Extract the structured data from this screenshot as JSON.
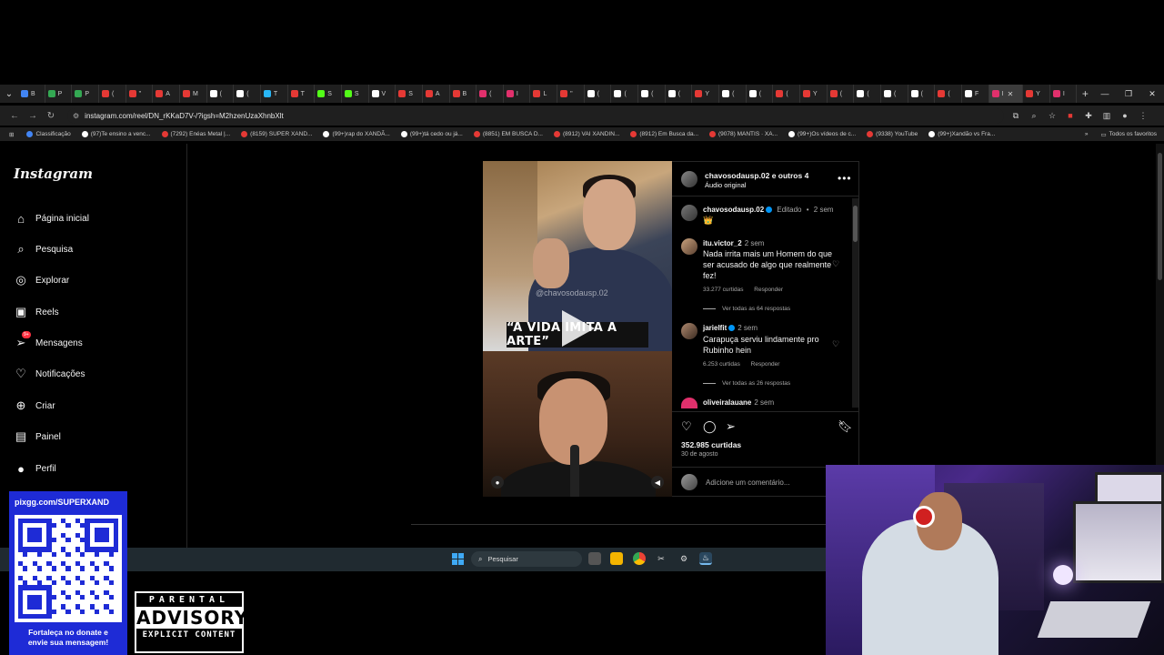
{
  "browser": {
    "tabs": [
      {
        "label": "B",
        "color": "#4285f4"
      },
      {
        "label": "P",
        "color": "#34a853"
      },
      {
        "label": "P",
        "color": "#34a853"
      },
      {
        "label": "(",
        "color": "#e53935"
      },
      {
        "label": "\"",
        "color": "#e53935"
      },
      {
        "label": "A",
        "color": "#e53935"
      },
      {
        "label": "M",
        "color": "#e53935"
      },
      {
        "label": "(",
        "color": "#ffffff"
      },
      {
        "label": "(",
        "color": "#ffffff"
      },
      {
        "label": "T",
        "color": "#29b6f6"
      },
      {
        "label": "T",
        "color": "#e53935"
      },
      {
        "label": "S",
        "color": "#53fc18"
      },
      {
        "label": "S",
        "color": "#53fc18"
      },
      {
        "label": "V",
        "color": "#ffffff"
      },
      {
        "label": "S",
        "color": "#e53935"
      },
      {
        "label": "A",
        "color": "#e53935"
      },
      {
        "label": "B",
        "color": "#e53935"
      },
      {
        "label": "(",
        "color": "#e1306c"
      },
      {
        "label": "I",
        "color": "#e1306c"
      },
      {
        "label": "L",
        "color": "#e53935"
      },
      {
        "label": "\"",
        "color": "#e53935"
      },
      {
        "label": "(",
        "color": "#ffffff"
      },
      {
        "label": "(",
        "color": "#ffffff"
      },
      {
        "label": "(",
        "color": "#ffffff"
      },
      {
        "label": "(",
        "color": "#ffffff"
      },
      {
        "label": "Y",
        "color": "#e53935"
      },
      {
        "label": "(",
        "color": "#ffffff"
      },
      {
        "label": "(",
        "color": "#ffffff"
      },
      {
        "label": "(",
        "color": "#e53935"
      },
      {
        "label": "Y",
        "color": "#e53935"
      },
      {
        "label": "(",
        "color": "#e53935"
      },
      {
        "label": "(",
        "color": "#ffffff"
      },
      {
        "label": "(",
        "color": "#ffffff"
      },
      {
        "label": "(",
        "color": "#ffffff"
      },
      {
        "label": "(",
        "color": "#e53935"
      },
      {
        "label": "F",
        "color": "#ffffff"
      }
    ],
    "active_tab": {
      "label": "I",
      "color": "#e1306c",
      "close": "✕"
    },
    "after_tabs": [
      {
        "label": "Y",
        "color": "#e53935"
      },
      {
        "label": "I",
        "color": "#e1306c"
      }
    ],
    "new_tab": "+",
    "url": "instagram.com/reel/DN_rKKaD7V-/?igsh=M2hzenUzaXhnbXlt",
    "bookmarks": [
      {
        "label": "Classificação",
        "color": "#4285f4"
      },
      {
        "label": "(97)Te ensino a venc...",
        "color": "#ffffff"
      },
      {
        "label": "(7292) Enéas Metal |...",
        "color": "#e53935"
      },
      {
        "label": "(8159) SUPER XAND...",
        "color": "#e53935"
      },
      {
        "label": "(99+)rap do XANDÃ...",
        "color": "#ffffff"
      },
      {
        "label": "(99+)tá cedo ou já...",
        "color": "#ffffff"
      },
      {
        "label": "(8851) EM BUSCA D...",
        "color": "#e53935"
      },
      {
        "label": "(8912) VAI XANDIN...",
        "color": "#e53935"
      },
      {
        "label": "(8912) Em Busca da...",
        "color": "#e53935"
      },
      {
        "label": "(9078) MANTIS · XA...",
        "color": "#e53935"
      },
      {
        "label": "(99+)Os vídeos de c...",
        "color": "#ffffff"
      },
      {
        "label": "(9338) YouTube",
        "color": "#e53935"
      },
      {
        "label": "(99+)Xandão vs Fra...",
        "color": "#ffffff"
      }
    ],
    "all_bookmarks": "Todos os favoritos"
  },
  "instagram": {
    "logo": "Instagram",
    "nav": [
      {
        "label": "Página inicial",
        "icon": "home-icon"
      },
      {
        "label": "Pesquisa",
        "icon": "search-icon"
      },
      {
        "label": "Explorar",
        "icon": "compass-icon"
      },
      {
        "label": "Reels",
        "icon": "reels-icon"
      },
      {
        "label": "Mensagens",
        "icon": "messenger-icon",
        "badge": "9+"
      },
      {
        "label": "Notificações",
        "icon": "heart-icon"
      },
      {
        "label": "Criar",
        "icon": "plus-square-icon"
      },
      {
        "label": "Painel",
        "icon": "dashboard-icon"
      },
      {
        "label": "Perfil",
        "icon": "profile-icon"
      }
    ],
    "reel": {
      "caption_text": "“A VIDA IMITA A ARTE”",
      "watermark": "@chavosodausp.02"
    },
    "panel": {
      "header_name": "chavosodausp.02 e outros 4",
      "header_sub": "Áudio original",
      "author": {
        "name": "chavosodausp.02",
        "edited": "Editado",
        "sep": "•",
        "time": "2 sem",
        "text": "👑"
      },
      "comments": [
        {
          "name": "itu.victor_2",
          "time": "2 sem",
          "text": "Nada irrita mais um Homem do que ser acusado de algo que realmente fez!",
          "likes": "33.277 curtidas",
          "reply": "Responder",
          "view_replies": "Ver todas as 64 respostas"
        },
        {
          "name": "jarielfit",
          "time": "2 sem",
          "text": "Carapuça serviu lindamente pro Rubinho hein",
          "likes": "6.253 curtidas",
          "reply": "Responder",
          "view_replies": "Ver todas as 26 respostas"
        },
        {
          "name": "oliveiralauane",
          "time": "2 sem"
        }
      ],
      "total_likes": "352.985 curtidas",
      "date": "30 de agosto",
      "add_comment_placeholder": "Adicione um comentário..."
    }
  },
  "taskbar": {
    "search_placeholder": "Pesquisar"
  },
  "overlay": {
    "donate_url": "pixgg.com/SUPERXAND",
    "donate_msg_1": "Fortaleça no donate e",
    "donate_msg_2": "envie sua mensagem!",
    "advisory_1": "PARENTAL",
    "advisory_2": "ADVISORY",
    "advisory_3": "EXPLICIT CONTENT"
  }
}
